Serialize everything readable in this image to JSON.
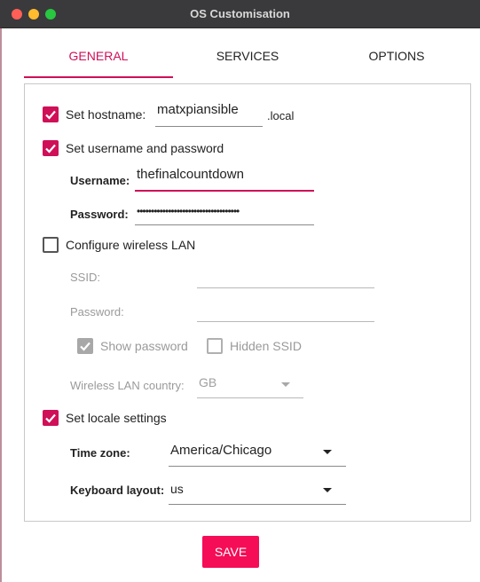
{
  "window": {
    "title": "OS Customisation"
  },
  "tabs": [
    {
      "label": "GENERAL",
      "active": true
    },
    {
      "label": "SERVICES",
      "active": false
    },
    {
      "label": "OPTIONS",
      "active": false
    }
  ],
  "hostname": {
    "label": "Set hostname:",
    "checked": true,
    "value": "matxpiansible",
    "suffix": ".local"
  },
  "user": {
    "label": "Set username and password",
    "checked": true,
    "username_label": "Username:",
    "username_value": "thefinalcountdown",
    "password_label": "Password:",
    "password_value": "••••••••••••••••••••••••••••••••••••"
  },
  "wlan": {
    "label": "Configure wireless LAN",
    "checked": false,
    "ssid_label": "SSID:",
    "ssid_value": "",
    "password_label": "Password:",
    "password_value": "",
    "show_password_label": "Show password",
    "show_password_checked": true,
    "hidden_ssid_label": "Hidden SSID",
    "hidden_ssid_checked": false,
    "country_label": "Wireless LAN country:",
    "country_value": "GB"
  },
  "locale": {
    "label": "Set locale settings",
    "checked": true,
    "timezone_label": "Time zone:",
    "timezone_value": "America/Chicago",
    "keyboard_label": "Keyboard layout:",
    "keyboard_value": "us"
  },
  "save_label": "SAVE",
  "colors": {
    "accent": "#cf1058",
    "save_button": "#f50d57",
    "titlebar": "#3a3a3c"
  }
}
